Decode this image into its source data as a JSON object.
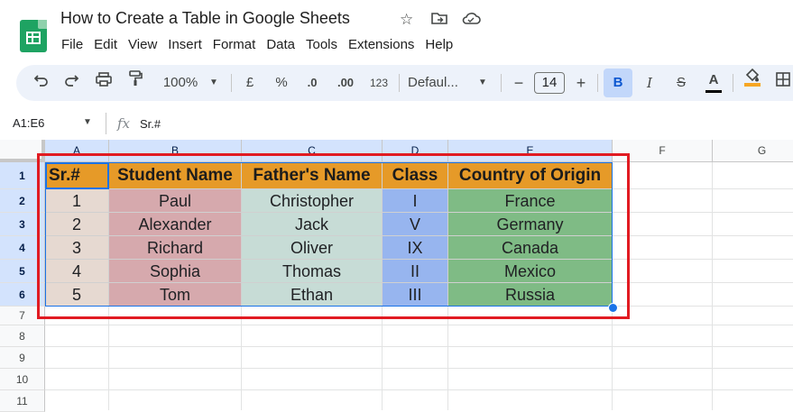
{
  "doc": {
    "title": "How to Create a Table in Google Sheets"
  },
  "menu": [
    "File",
    "Edit",
    "View",
    "Insert",
    "Format",
    "Data",
    "Tools",
    "Extensions",
    "Help"
  ],
  "toolbar": {
    "zoom": "100%",
    "currency": "£",
    "percent": "%",
    "decrease_decimals": ".0",
    "increase_decimals": ".00",
    "more_formats": "123",
    "font": "Defaul...",
    "font_size": "14",
    "bold": "B",
    "italic": "I",
    "strikethrough": "S",
    "text_color": "A",
    "text_color_bar": "#000000",
    "fill_color_bar": "#f6a623"
  },
  "formula_bar": {
    "name_box": "A1:E6",
    "fx": "fx",
    "value": "Sr.#"
  },
  "columns": [
    "A",
    "B",
    "C",
    "D",
    "E",
    "F",
    "G"
  ],
  "rows": [
    "1",
    "2",
    "3",
    "4",
    "5",
    "6",
    "7",
    "8",
    "9",
    "10",
    "11"
  ],
  "table": {
    "header": [
      "Sr.#",
      "Student Name",
      "Father's Name",
      "Class",
      "Country of Origin"
    ],
    "rows": [
      [
        "1",
        "Paul",
        "Christopher",
        "I",
        "France"
      ],
      [
        "2",
        "Alexander",
        "Jack",
        "V",
        "Germany"
      ],
      [
        "3",
        "Richard",
        "Oliver",
        "IX",
        "Canada"
      ],
      [
        "4",
        "Sophia",
        "Thomas",
        "II",
        "Mexico"
      ],
      [
        "5",
        "Tom",
        "Ethan",
        "III",
        "Russia"
      ]
    ],
    "column_colors": [
      "#e6d9d1",
      "#d6a9ad",
      "#c7dcd6",
      "#97b5ef",
      "#7fbb85"
    ],
    "header_color": "#e69a28"
  },
  "colors": {
    "accent": "#1a73e8",
    "highlight": "#e11b22",
    "logo": "#1ea362"
  }
}
